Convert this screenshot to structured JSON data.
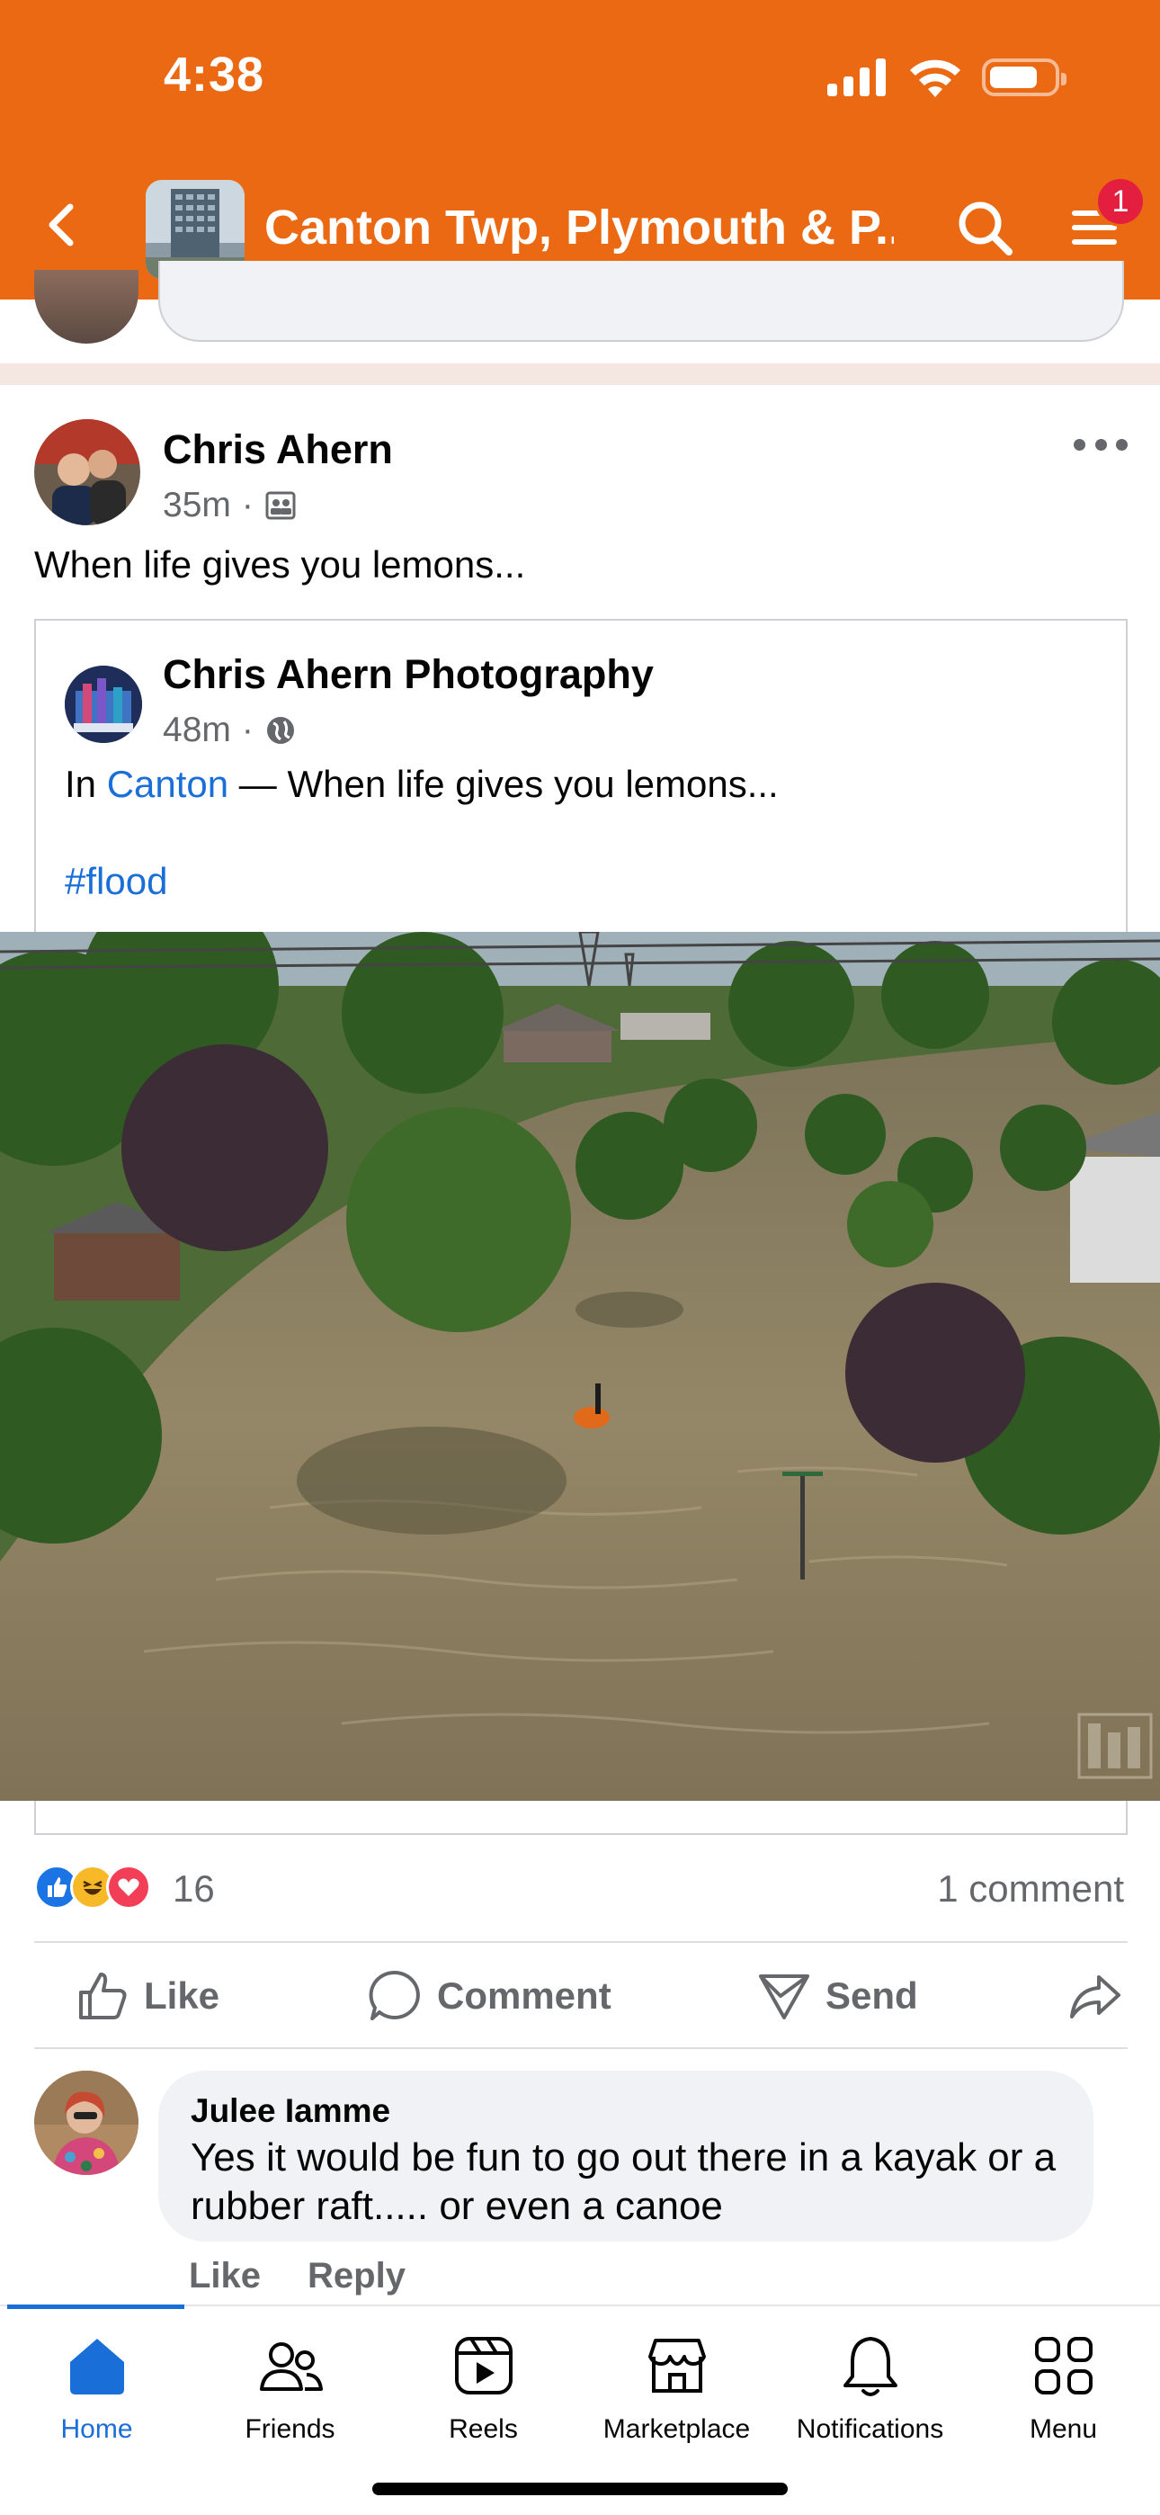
{
  "status_bar": {
    "time": "4:38"
  },
  "header": {
    "group_name": "Canton Twp, Plymouth & P...",
    "menu_badge": "1"
  },
  "post": {
    "author": "Chris Ahern",
    "time": "35m",
    "text": "When life gives you lemons...",
    "shared": {
      "author": "Chris Ahern Photography",
      "time": "48m",
      "text_prefix": "In ",
      "location": "Canton",
      "text_suffix": " — When life gives you lemons...",
      "hashtag": "#flood"
    },
    "reaction_count": "16",
    "comment_count": "1 comment",
    "actions": {
      "like": "Like",
      "comment": "Comment",
      "send": "Send"
    }
  },
  "comment": {
    "author": "Julee Iamme",
    "text": "Yes it would be fun to go out there in a kayak or a rubber raft..... or even a canoe",
    "like": "Like",
    "reply": "Reply"
  },
  "tabs": [
    {
      "label": "Home",
      "icon": "home-icon",
      "active": true
    },
    {
      "label": "Friends",
      "icon": "friends-icon"
    },
    {
      "label": "Reels",
      "icon": "reels-icon"
    },
    {
      "label": "Marketplace",
      "icon": "marketplace-icon"
    },
    {
      "label": "Notifications",
      "icon": "bell-icon"
    },
    {
      "label": "Menu",
      "icon": "menu-grid-icon"
    }
  ],
  "colors": {
    "brand": "#ea6912",
    "link": "#1a6ed8",
    "badge": "#e41e3f"
  }
}
